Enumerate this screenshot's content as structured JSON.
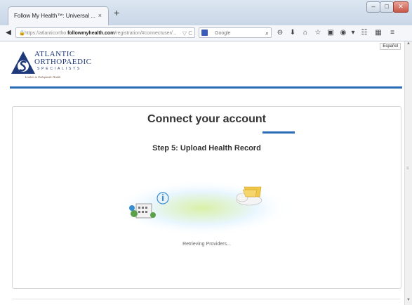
{
  "browser": {
    "tab_title": "Follow My Health™: Universal ...",
    "tab_close": "×",
    "new_tab": "+",
    "window_buttons": {
      "minimize": "–",
      "maximize": "□",
      "close": "✕"
    },
    "url_prefix": "https://atlanticortho.",
    "url_domain": "followmyhealth.com",
    "url_path": "/registration/#connectuser/...",
    "url_controls": "▽ C",
    "search_placeholder": "Google",
    "toolbar_icons": [
      "⊖",
      "⬇",
      "⌂",
      "☆",
      "▣",
      "◉",
      "▾",
      "☷",
      "▦",
      "≡"
    ]
  },
  "page": {
    "logo": {
      "line1": "ATLANTIC",
      "line2": "ORTHOPAEDIC",
      "line3": "SPECIALISTS",
      "tagline": "Leaders in Orthopaedic Health"
    },
    "language_button": "Español",
    "heading": "Connect your account",
    "step": "Step 5: Upload Health Record",
    "status": "Retrieving Providers..."
  },
  "colors": {
    "accent": "#2b6cb8",
    "logo_blue": "#1f3a7a"
  }
}
